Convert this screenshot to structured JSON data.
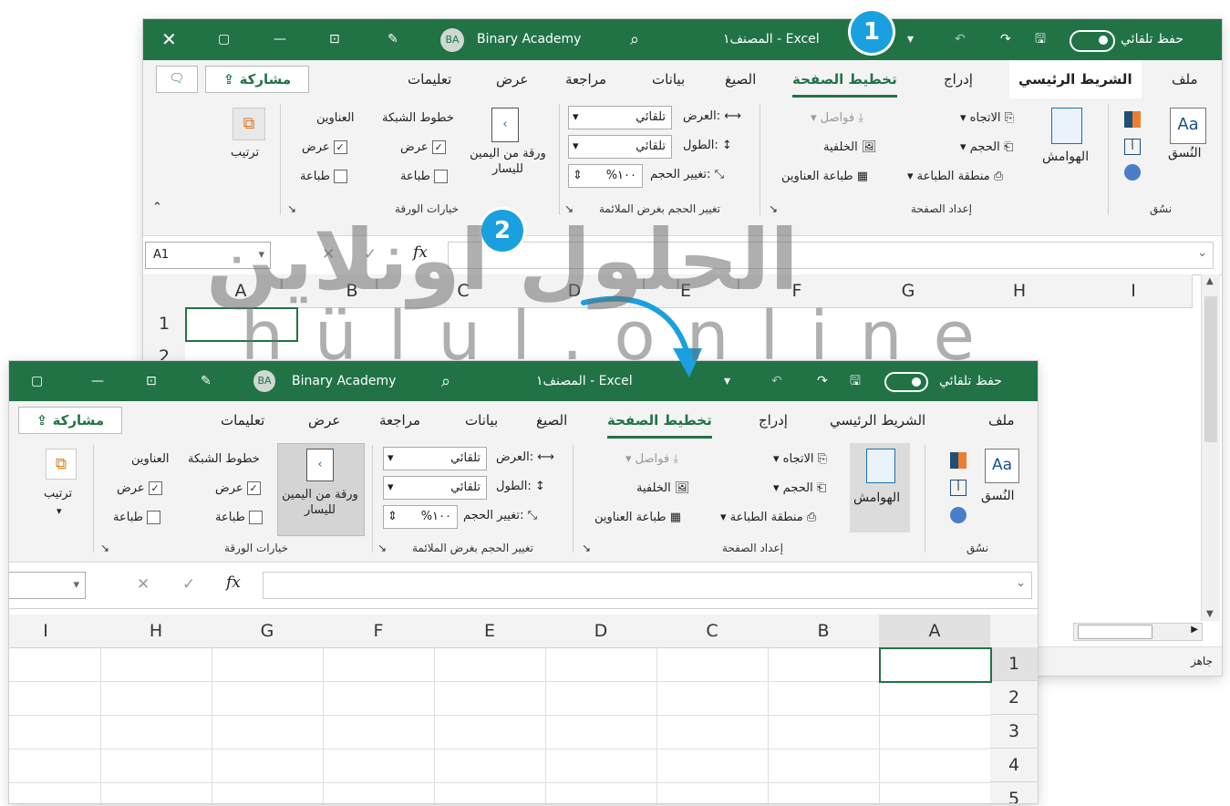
{
  "title": {
    "autosave": "حفظ تلقائي",
    "doc": "المصنف١ - Excel",
    "user_initials": "BA",
    "user_name": "Binary Academy"
  },
  "tabs": [
    "ملف",
    "الشريط الرئيسي",
    "إدراج",
    "تخطيط الصفحة",
    "الصيغ",
    "بيانات",
    "مراجعة",
    "عرض",
    "تعليمات"
  ],
  "share": "مشاركة",
  "ribbon": {
    "themes": {
      "label": "النُسق",
      "group": "نسُق"
    },
    "margins": "الهوامش",
    "orientation": "الاتجاه",
    "size": "الحجم",
    "print_area": "منطقة الطباعة",
    "breaks": "فواصل",
    "background": "الخلفية",
    "print_titles": "طباعة العناوين",
    "page_setup_group": "إعداد الصفحة",
    "width_label": "العرض:",
    "width_value": "تلقائي",
    "height_label": "الطول:",
    "height_value": "تلقائي",
    "scale_label": "تغيير الحجم:",
    "scale_value": "%١٠٠",
    "scale_group": "تغيير الحجم بغرض الملائمة",
    "sheet_rtl": "ورقة من اليمين لليسار",
    "gridlines": "خطوط الشبكة",
    "headings": "العناوين",
    "view": "عرض",
    "print": "طباعة",
    "sheet_options_group": "خيارات الورقة",
    "arrange": "ترتيب"
  },
  "name_box": "A1",
  "fx": "fx",
  "columns": [
    "A",
    "B",
    "C",
    "D",
    "E",
    "F",
    "G",
    "H",
    "I"
  ],
  "rows": [
    "1",
    "2",
    "3",
    "4",
    "5"
  ],
  "status": "جاهز",
  "badges": [
    "1",
    "2"
  ],
  "watermark": {
    "arabic": "الحلول اونلاين",
    "latin": "hülul.online"
  },
  "colors": {
    "excel_green": "#217346",
    "badge_blue": "#1aa0de"
  }
}
